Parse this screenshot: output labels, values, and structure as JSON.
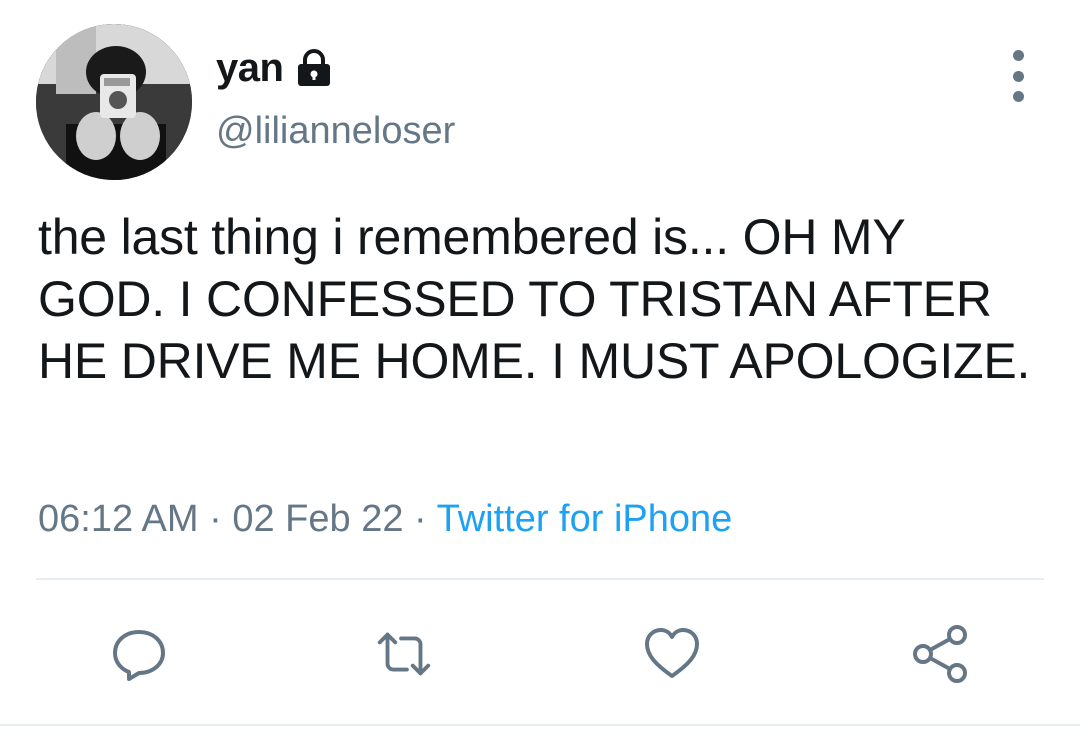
{
  "author": {
    "display_name": "yan",
    "handle": "@lilianneloser",
    "protected": true
  },
  "tweet": {
    "text": "the last thing i remembered is... OH MY GOD. I CONFESSED TO TRISTAN AFTER HE DRIVE ME HOME. I MUST APOLOGIZE."
  },
  "meta": {
    "time": "06:12 AM",
    "separator": "·",
    "date": "02 Feb 22",
    "source": "Twitter for iPhone"
  },
  "icons": {
    "lock": "lock-icon",
    "more": "more-vertical-icon",
    "reply": "reply-icon",
    "retweet": "retweet-icon",
    "like": "heart-icon",
    "share": "share-icon"
  },
  "colors": {
    "text": "#14171a",
    "secondary": "#657786",
    "link": "#1da1f2",
    "divider": "#e6ecf0"
  }
}
